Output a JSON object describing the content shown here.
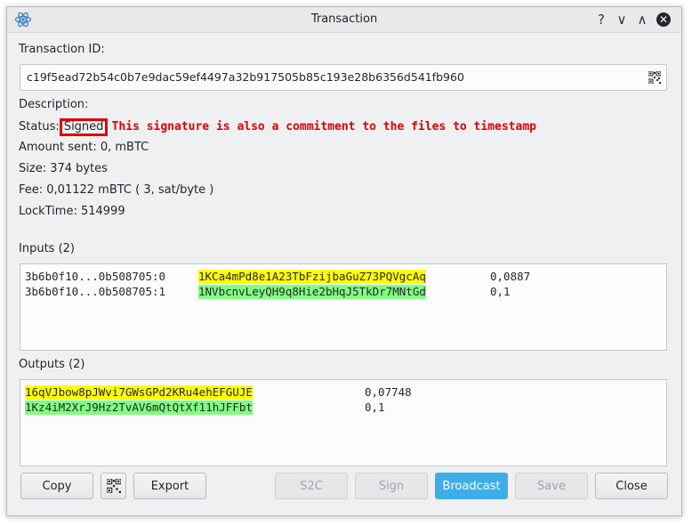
{
  "window": {
    "title": "Transaction",
    "help_glyph": "?",
    "minimize_glyph": "∨",
    "maximize_glyph": "∧",
    "close_glyph": "✕"
  },
  "txid": {
    "label": "Transaction ID:",
    "value": "c19f5ead72b54c0b7e9dac59ef4497a32b917505b85c193e28b6356d541fb960"
  },
  "details": {
    "description_label": "Description:",
    "status_label": "Status:",
    "status_value": "Signed",
    "annotation": "This signature is also a commitment to the files to timestamp",
    "amount": "Amount sent: 0, mBTC",
    "size": "Size: 374 bytes",
    "fee": "Fee: 0,01122 mBTC  ( 3, sat/byte )",
    "locktime": "LockTime: 514999"
  },
  "inputs": {
    "label": "Inputs (2)",
    "rows": [
      {
        "prevout": "3b6b0f10...0b508705:0",
        "address": "1KCa4mPd8e1A23TbFzijbaGuZ73PQVgcAq",
        "amount": "0,0887",
        "highlight": "#ffff00"
      },
      {
        "prevout": "3b6b0f10...0b508705:1",
        "address": "1NVbcnvLeyQH9q8Hie2bHqJ5TkDr7MNtGd",
        "amount": "0,1",
        "highlight": "#80ff80"
      }
    ]
  },
  "outputs": {
    "label": "Outputs (2)",
    "rows": [
      {
        "address": "16qVJbow8pJWvi7GWsGPd2KRu4ehEFGUJE",
        "amount": "0,07748",
        "highlight": "#ffff00"
      },
      {
        "address": "1Kz4iM2XrJ9Hz2TvAV6mQtQtXf11hJFFbt",
        "amount": "0,1",
        "highlight": "#80ff80"
      }
    ]
  },
  "buttons": {
    "copy": "Copy",
    "export": "Export",
    "s2c": "S2C",
    "sign": "Sign",
    "broadcast": "Broadcast",
    "save": "Save",
    "close": "Close"
  },
  "colors": {
    "accent": "#3daee9",
    "annotation_red": "#e00000",
    "highlight_yellow": "#ffff00",
    "highlight_green": "#80ff80"
  },
  "icons": {
    "app": "electrum-icon",
    "qr": "qrcode-icon"
  }
}
